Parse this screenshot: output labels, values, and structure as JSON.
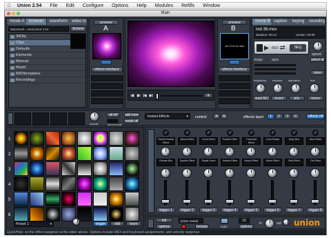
{
  "menubar": {
    "apple_icon": "apple-icon",
    "items": [
      "Union 2.54",
      "File",
      "Edit",
      "Configure",
      "Options",
      "Help",
      "Modules",
      "Refills",
      "Window"
    ]
  },
  "window": {
    "title": "Main"
  },
  "left_panel": {
    "tabs": [
      "movie A",
      "browser",
      "waveform",
      "video in"
    ],
    "path_label": "browse",
    "path_value": "Macintosh...om/union2 2.54",
    "folders": [
      "3dObj",
      "Clips",
      "Defaults",
      "Elements",
      "Manual",
      "MaskI",
      "MIDItemplates",
      "Recordings"
    ]
  },
  "preview_a": {
    "label": "preview",
    "deck": "A",
    "button": "effects interface"
  },
  "preview_b": {
    "label": "preview",
    "deck": "B",
    "button": "effects interface",
    "empty_text": "use 'B' for do clips"
  },
  "transport": {
    "position": "4",
    "speed_label": "speed"
  },
  "right_panel": {
    "tabs": [
      "movie B",
      "caption",
      "keying",
      "soundtrg"
    ],
    "filename": "lvid 36.mov",
    "duration": "duration: 00:14",
    "remain": "remain: 00:00",
    "rev_label": "REV",
    "seq_label": "SEQ",
    "loops_label": "loops",
    "sync_label": "sync",
    "select_all": "select all",
    "store_label": "store",
    "knobs": [
      "brightness",
      "contrast",
      "saturation",
      "hue"
    ],
    "buttons": [
      "reset BCS",
      "invert",
      "b/w",
      "mono"
    ]
  },
  "mixer": {
    "opacity_label": "opacity",
    "all_off": "all off",
    "add_more": "add more",
    "blend_mode_label": "blend mode",
    "mode_off": "mode off",
    "instant_effects": "Instant Effects",
    "control_label": "control",
    "a": "A",
    "b": "B",
    "effects_layer": "effects layer",
    "layers": [
      "1",
      "2",
      "3",
      "4"
    ],
    "effects_off": "effects off"
  },
  "effects": {
    "columns": [
      {
        "name": "Particle Bubble Effect",
        "name2": "Pulsate Blur",
        "trigger": "trigger 1"
      },
      {
        "name": "Bloom Effect",
        "name2": "Sparkle Effect",
        "trigger": "trigger 2"
      },
      {
        "name": "Invert Effect",
        "name2": "Ripple Zoom",
        "trigger": "trigger 3"
      },
      {
        "name": "Pulsate Effect",
        "name2": "Kaleido Effect",
        "trigger": "trigger 4"
      },
      {
        "name": "Threshold Effect",
        "name2": "Morph Effect",
        "trigger": "trigger 5"
      },
      {
        "name": "Color Rotate",
        "name2": "Mirror Effect",
        "trigger": "trigger 6"
      },
      {
        "name": "Deep Blur",
        "name2": "Shift Effect",
        "trigger": "trigger 7"
      },
      {
        "name": "Glow Effect",
        "name2": "Tint Effect",
        "trigger": "trigger 8"
      }
    ]
  },
  "clip_bank": {
    "rows": [
      "1",
      "2",
      "3",
      "4",
      "5",
      "6"
    ],
    "preset": "Preset 1",
    "trigger": "trigger",
    "edit": "edit",
    "learn": "learn"
  },
  "bottom_bar": {
    "full_label": "full",
    "options_label": "options",
    "enter_name": "[enter name]",
    "browse_label": "browse",
    "tools_label": "tools",
    "options2_label": "options",
    "in_label": "in",
    "out_label": "out",
    "logo": "union",
    "recall_label": "10"
  },
  "status": "QuickHelp: on the effect assigned at the slider above. Options include MIDI and Keyboard assignments, and velocity response"
}
